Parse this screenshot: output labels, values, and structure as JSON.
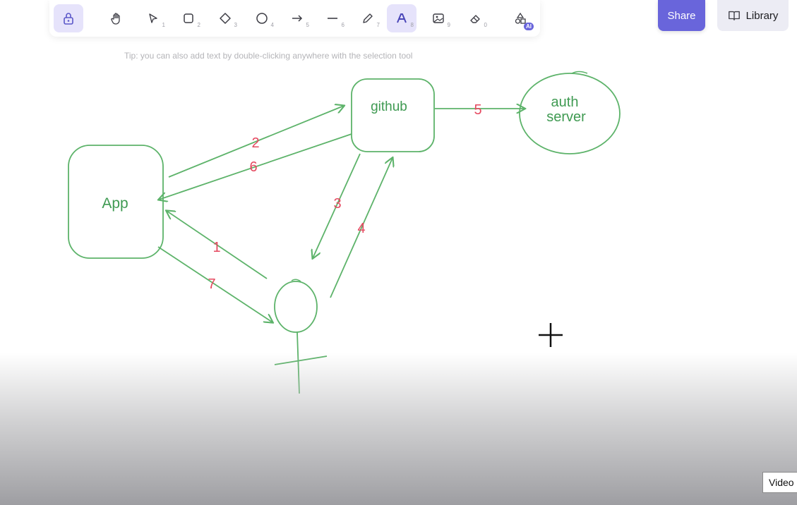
{
  "toolbar": {
    "tools": [
      {
        "name": "lock",
        "key": ""
      },
      {
        "name": "hand",
        "key": ""
      },
      {
        "name": "selection",
        "key": "1"
      },
      {
        "name": "rectangle",
        "key": "2"
      },
      {
        "name": "diamond",
        "key": "3"
      },
      {
        "name": "ellipse",
        "key": "4"
      },
      {
        "name": "arrow",
        "key": "5"
      },
      {
        "name": "line",
        "key": "6"
      },
      {
        "name": "draw",
        "key": "7"
      },
      {
        "name": "text",
        "key": "8"
      },
      {
        "name": "image",
        "key": "9"
      },
      {
        "name": "eraser",
        "key": "0"
      },
      {
        "name": "more-shapes",
        "key": "AI"
      }
    ]
  },
  "header": {
    "share_label": "Share",
    "library_label": "Library"
  },
  "tip": "Tip: you can also add text by double-clicking anywhere with the selection tool",
  "diagram": {
    "nodes": {
      "app": "App",
      "github": "github",
      "auth_line1": "auth",
      "auth_line2": "server"
    },
    "steps": [
      "1",
      "2",
      "3",
      "4",
      "5",
      "6",
      "7"
    ]
  },
  "video_label": "Video",
  "colors": {
    "accent": "#6965db",
    "shape_stroke": "#5db36a",
    "shape_text": "#3f9a52",
    "step_text": "#e5485f"
  }
}
